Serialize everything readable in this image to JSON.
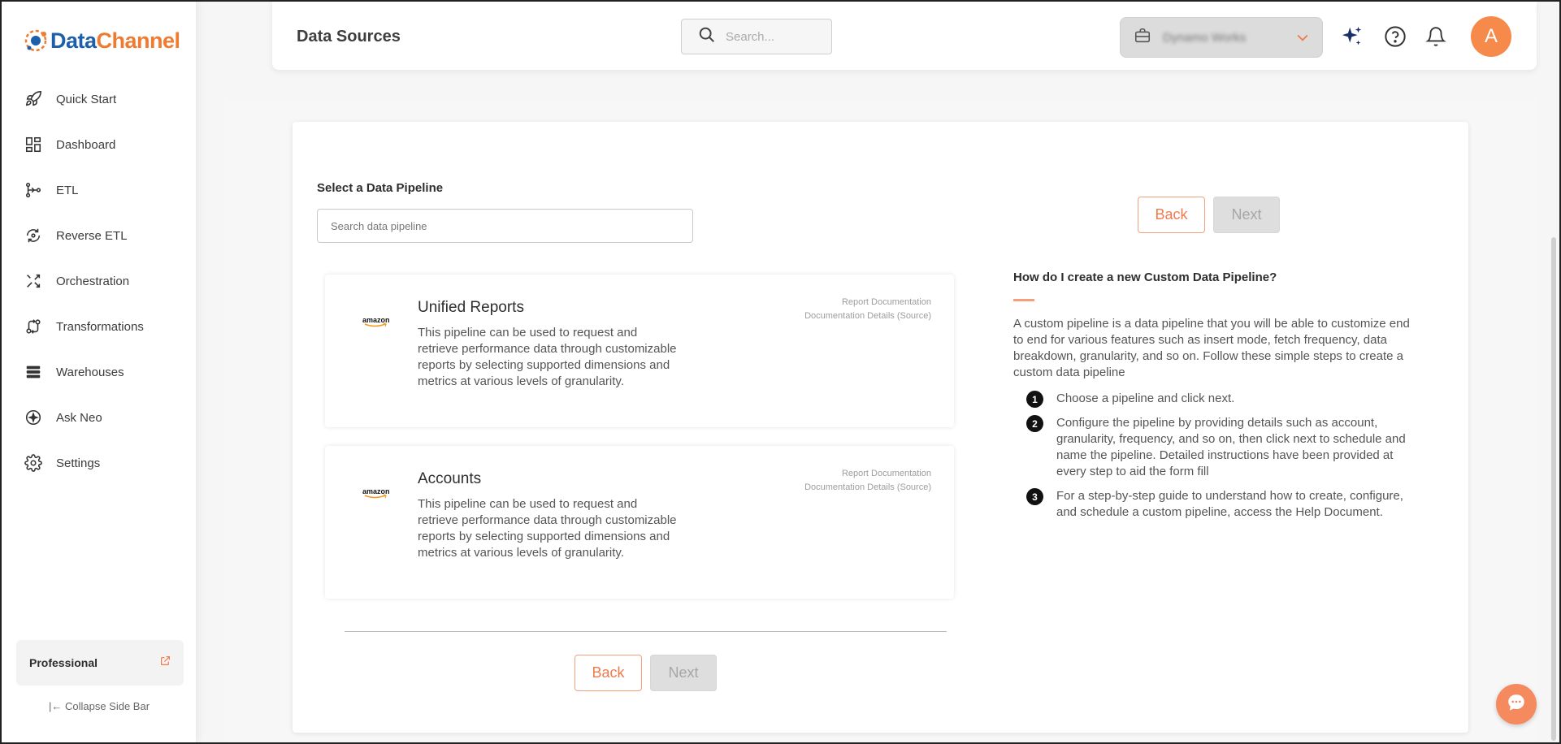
{
  "brand": {
    "name_part1": "Data",
    "name_part2": "Channel",
    "color_blue": "#1d5fa8",
    "color_orange": "#f07a2f"
  },
  "sidebar": {
    "items": [
      {
        "label": "Quick Start",
        "icon": "rocket-icon"
      },
      {
        "label": "Dashboard",
        "icon": "dashboard-icon"
      },
      {
        "label": "ETL",
        "icon": "etl-icon"
      },
      {
        "label": "Reverse ETL",
        "icon": "reverse-etl-icon"
      },
      {
        "label": "Orchestration",
        "icon": "orchestration-icon"
      },
      {
        "label": "Transformations",
        "icon": "transformations-icon"
      },
      {
        "label": "Warehouses",
        "icon": "warehouses-icon"
      },
      {
        "label": "Ask Neo",
        "icon": "ask-neo-icon"
      },
      {
        "label": "Settings",
        "icon": "gear-icon"
      }
    ],
    "plan_label": "Professional",
    "collapse_label": "Collapse Side Bar"
  },
  "header": {
    "title": "Data Sources",
    "search_placeholder": "Search...",
    "workspace_name": "Dynamo Works",
    "avatar_letter": "A",
    "accent_color": "#f58a4b"
  },
  "main": {
    "section_label": "Select a Data Pipeline",
    "pipeline_search_placeholder": "Search data pipeline",
    "back_label": "Back",
    "next_label": "Next",
    "pipelines": [
      {
        "title": "Unified Reports",
        "logo_text": "amazon",
        "description": "This pipeline can be used to request and retrieve performance data through customizable reports by selecting supported dimensions and metrics at various levels of granularity.",
        "link1": "Report Documentation",
        "link2": "Documentation Details (Source)"
      },
      {
        "title": "Accounts",
        "logo_text": "amazon",
        "description": "This pipeline can be used to request and retrieve performance data through customizable reports by selecting supported dimensions and metrics at various levels of granularity.",
        "link1": "Report Documentation",
        "link2": "Documentation Details (Source)"
      }
    ]
  },
  "help": {
    "title": "How do I create a new Custom Data Pipeline?",
    "intro": "A custom pipeline is a data pipeline that you will be able to customize end to end for various features such as insert mode, fetch frequency, data breakdown, granularity, and so on. Follow these simple steps to create a custom data pipeline",
    "steps": [
      {
        "num": "1",
        "text": "Choose a pipeline and click next."
      },
      {
        "num": "2",
        "text": "Configure the pipeline by providing details such as account, granularity, frequency, and so on, then click next to schedule and name the pipeline. Detailed instructions have been provided at every step to aid the form fill"
      },
      {
        "num": "3",
        "text": "For a step-by-step guide to understand how to create, configure, and schedule a custom pipeline, access the Help Document."
      }
    ]
  }
}
